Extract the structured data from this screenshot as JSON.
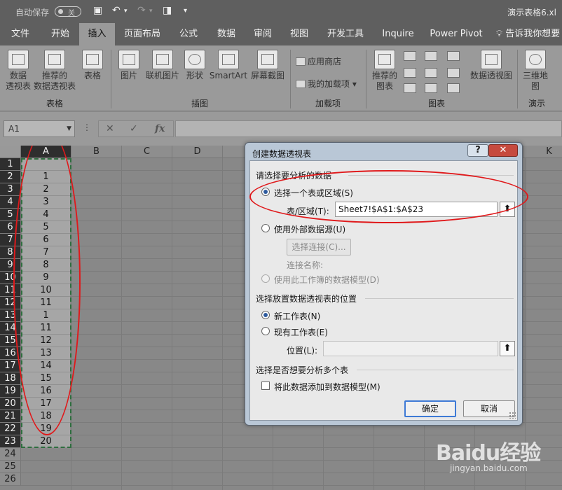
{
  "titlebar": {
    "autosave_label": "自动保存",
    "autosave_toggle": "关",
    "doc_title": "演示表格6.xl"
  },
  "tabs": [
    "文件",
    "开始",
    "插入",
    "页面布局",
    "公式",
    "数据",
    "审阅",
    "视图",
    "开发工具",
    "Inquire",
    "Power Pivot",
    "告诉我你想要"
  ],
  "active_tab": "插入",
  "ribbon": {
    "pivot_table": "数据\n透视表",
    "pivot_table_l1": "数据",
    "pivot_table_l2": "透视表",
    "recommended_pivot_l1": "推荐的",
    "recommended_pivot_l2": "数据透视表",
    "table": "表格",
    "group_tables": "表格",
    "pictures": "图片",
    "online_pictures": "联机图片",
    "shapes": "形状",
    "smartart": "SmartArt",
    "screenshot": "屏幕截图",
    "group_illustrations": "插图",
    "store": "应用商店",
    "my_addins": "我的加载项",
    "group_addins": "加载项",
    "recommended_charts_l1": "推荐的",
    "recommended_charts_l2": "图表",
    "pivot_chart": "数据透视图",
    "group_charts": "图表",
    "map3d_l1": "三维地",
    "map3d_l2": "图",
    "group_tours": "演示"
  },
  "formula_bar": {
    "name_box": "A1",
    "fx": "fx"
  },
  "grid": {
    "columns": [
      "A",
      "B",
      "C",
      "D",
      "K"
    ],
    "rows": [
      "1",
      "2",
      "3",
      "4",
      "5",
      "6",
      "7",
      "8",
      "9",
      "10",
      "11",
      "12",
      "13",
      "14",
      "15",
      "16",
      "17",
      "18",
      "19",
      "20",
      "21",
      "22",
      "23",
      "24",
      "25",
      "26"
    ],
    "col_a_values": [
      "",
      "1",
      "2",
      "3",
      "4",
      "5",
      "6",
      "7",
      "8",
      "9",
      "10",
      "11",
      "1",
      "11",
      "12",
      "13",
      "14",
      "15",
      "16",
      "17",
      "18",
      "19",
      "20"
    ]
  },
  "dialog": {
    "title": "创建数据透视表",
    "help": "?",
    "close": "✕",
    "section1": "请选择要分析的数据",
    "opt_select_range": "选择一个表或区域(S)",
    "table_range_label": "表/区域(T):",
    "table_range_value": "Sheet7!$A$1:$A$23",
    "opt_external": "使用外部数据源(U)",
    "choose_connection": "选择连接(C)...",
    "connection_name": "连接名称:",
    "opt_data_model": "使用此工作簿的数据模型(D)",
    "section2": "选择放置数据透视表的位置",
    "opt_new_sheet": "新工作表(N)",
    "opt_existing_sheet": "现有工作表(E)",
    "location_label": "位置(L):",
    "location_value": "",
    "section3": "选择是否想要分析多个表",
    "add_to_model": "将此数据添加到数据模型(M)",
    "ok": "确定",
    "cancel": "取消",
    "picker_glyph": "⬆"
  },
  "watermark": {
    "line1": "Baidu经验",
    "line2": "jingyan.baidu.com"
  },
  "colors": {
    "dark_chrome": "#5f5f5f",
    "ribbon_gray": "#9a9a9a",
    "marching_ants": "#2f6e3f",
    "annotation_red": "#e0191b",
    "ok_focus_blue": "#3e7ad6"
  }
}
